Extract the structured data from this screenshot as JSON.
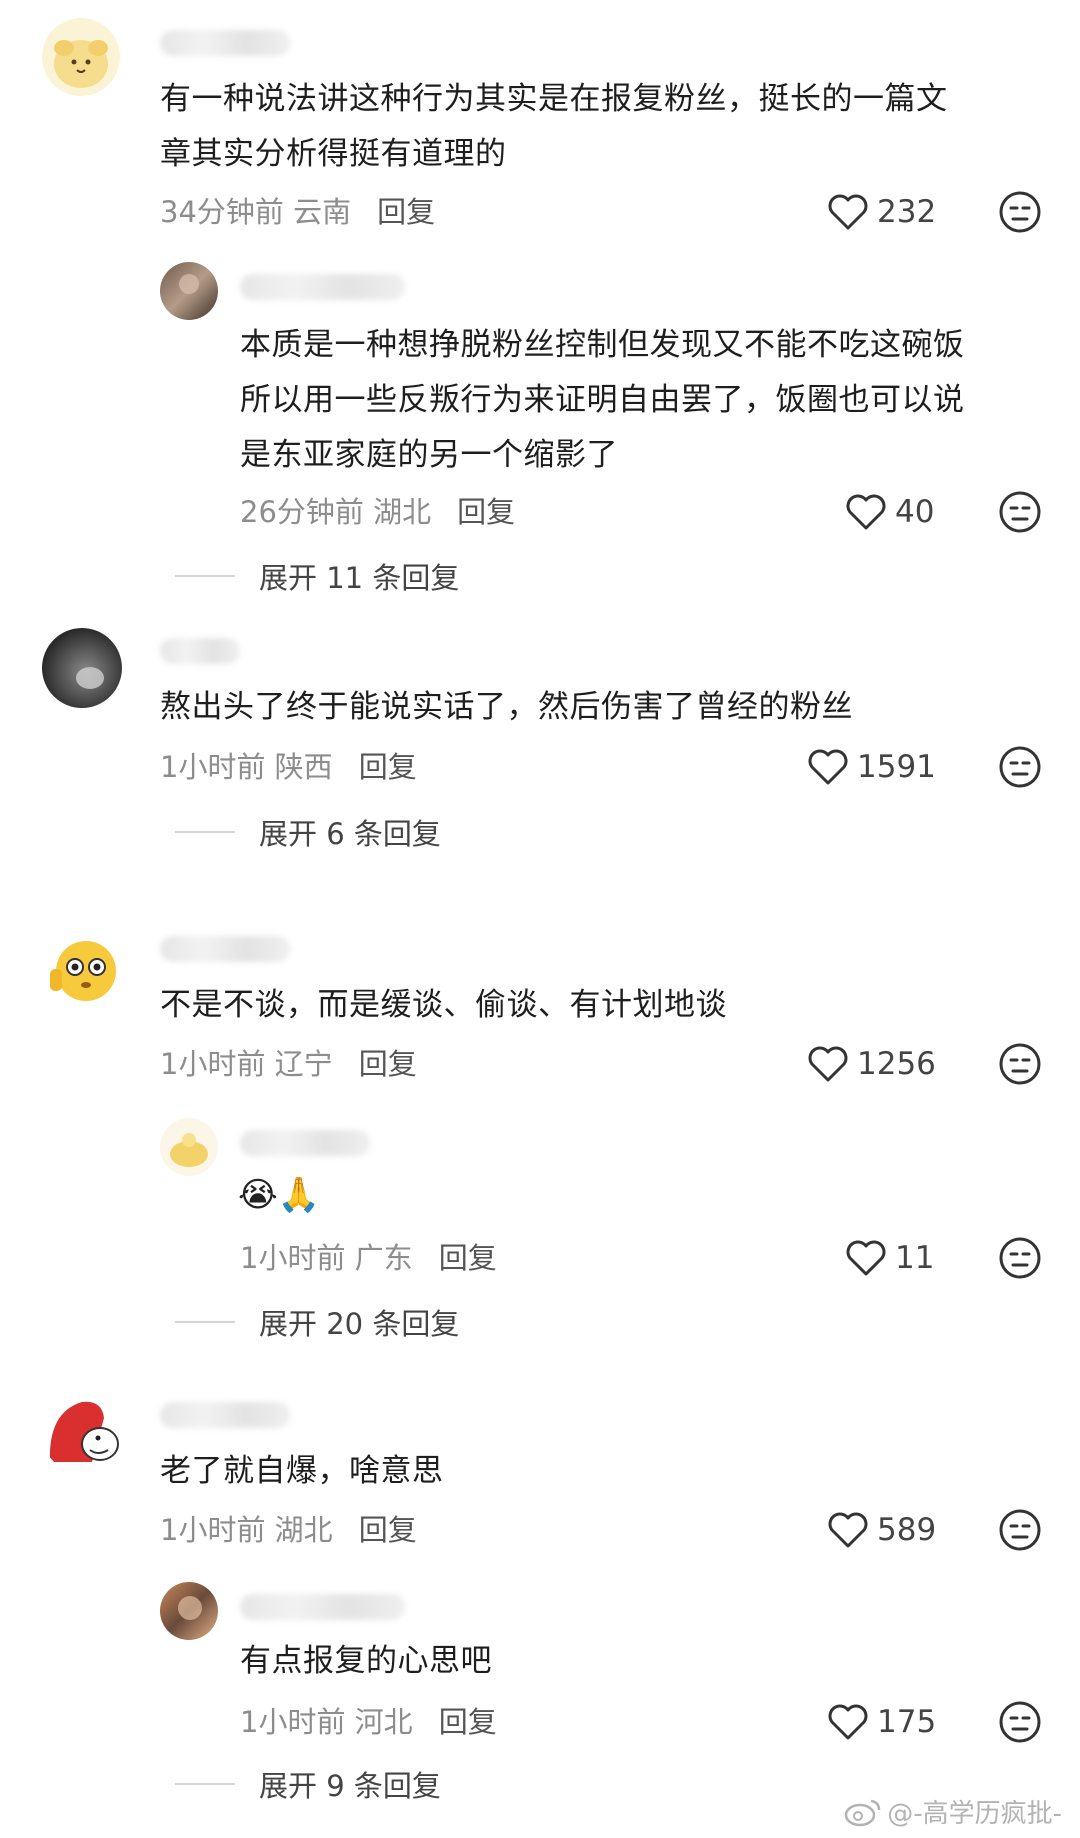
{
  "comments": [
    {
      "text_lines": [
        "有一种说法讲这种行为其实是在报复粉丝，挺长的一篇文",
        "章其实分析得挺有道理的"
      ],
      "time": "34分钟前",
      "location": "云南",
      "reply_label": "回复",
      "likes": "232",
      "avatar_icon": "pudding-dog-avatar"
    },
    {
      "text_lines": [
        "本质是一种想挣脱粉丝控制但发现又不能不吃这碗饭",
        "所以用一些反叛行为来证明自由罢了，饭圈也可以说",
        "是东亚家庭的另一个缩影了"
      ],
      "time": "26分钟前",
      "location": "湖北",
      "reply_label": "回复",
      "likes": "40",
      "expand_label": "展开 11 条回复",
      "avatar_icon": "photo-avatar"
    },
    {
      "text_lines": [
        "熬出头了终于能说实话了，然后伤害了曾经的粉丝"
      ],
      "time": "1小时前",
      "location": "陕西",
      "reply_label": "回复",
      "likes": "1591",
      "expand_label": "展开 6 条回复",
      "avatar_icon": "dark-photo-avatar"
    },
    {
      "text_lines": [
        "不是不谈，而是缓谈、偷谈、有计划地谈"
      ],
      "time": "1小时前",
      "location": "辽宁",
      "reply_label": "回复",
      "likes": "1256",
      "avatar_icon": "emoji-face-avatar"
    },
    {
      "text_lines": [
        "😭🙏"
      ],
      "time": "1小时前",
      "location": "广东",
      "reply_label": "回复",
      "likes": "11",
      "expand_label": "展开 20 条回复",
      "avatar_icon": "yellow-chick-avatar"
    },
    {
      "text_lines": [
        "老了就自爆，啥意思"
      ],
      "time": "1小时前",
      "location": "湖北",
      "reply_label": "回复",
      "likes": "589",
      "avatar_icon": "red-hood-cartoon-avatar"
    },
    {
      "text_lines": [
        "有点报复的心思吧"
      ],
      "time": "1小时前",
      "location": "河北",
      "reply_label": "回复",
      "likes": "175",
      "expand_label": "展开 9 条回复",
      "avatar_icon": "blurred-photo-avatar"
    }
  ],
  "watermark": "@-高学历疯批-",
  "icons": {
    "like": "heart-outline-icon",
    "dislike": "unamused-face-icon",
    "watermark": "weibo-logo-icon"
  },
  "colors": {
    "text": "#1e1e1e",
    "meta": "#8d8d8d",
    "icon": "#333333"
  }
}
